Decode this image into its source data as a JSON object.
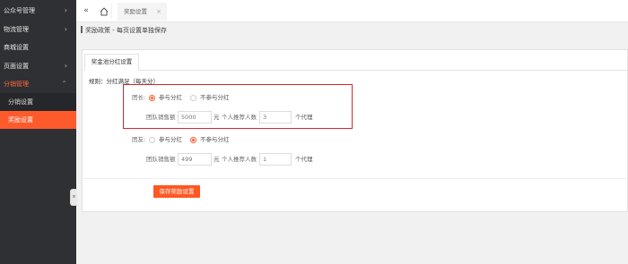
{
  "sidebar": {
    "items": [
      {
        "label": "公众号管理"
      },
      {
        "label": "物流管理"
      },
      {
        "label": "商城设置"
      },
      {
        "label": "页面设置"
      },
      {
        "label": "分销管理"
      }
    ],
    "subitems": [
      {
        "label": "分销设置"
      },
      {
        "label": "奖励设置"
      }
    ]
  },
  "topbar": {
    "collapse_icon": "«",
    "tab_label": "奖励设置",
    "tab_close": "×"
  },
  "breadcrumb": {
    "text": "奖励政策 - 每页设置单独保存"
  },
  "panel": {
    "tab_label": "奖金池分红设置",
    "rule_text": "规则：分红满足（每天分）",
    "leader": {
      "label": "团长:",
      "option_join": "参与分红",
      "option_not_join": "不参与分红",
      "selected": "参与分红",
      "sales_label": "团队销售额",
      "sales_value": "5000",
      "sales_unit": "元",
      "recommend_label": "个人推荐人数",
      "recommend_value": "3",
      "recommend_unit": "个代理"
    },
    "team": {
      "label": "团友:",
      "option_join": "参与分红",
      "option_not_join": "不参与分红",
      "selected": "不参与分红",
      "sales_label": "团队销售额",
      "sales_value": "499",
      "sales_unit": "元",
      "recommend_label": "个人推荐人数",
      "recommend_value": "1",
      "recommend_unit": "个代理"
    },
    "save_label": "保存奖励设置"
  },
  "handle_label": "≡",
  "colors": {
    "accent": "#ff5a2c",
    "sidebar_bg": "#2f3033",
    "highlight_border": "#d8262d"
  }
}
